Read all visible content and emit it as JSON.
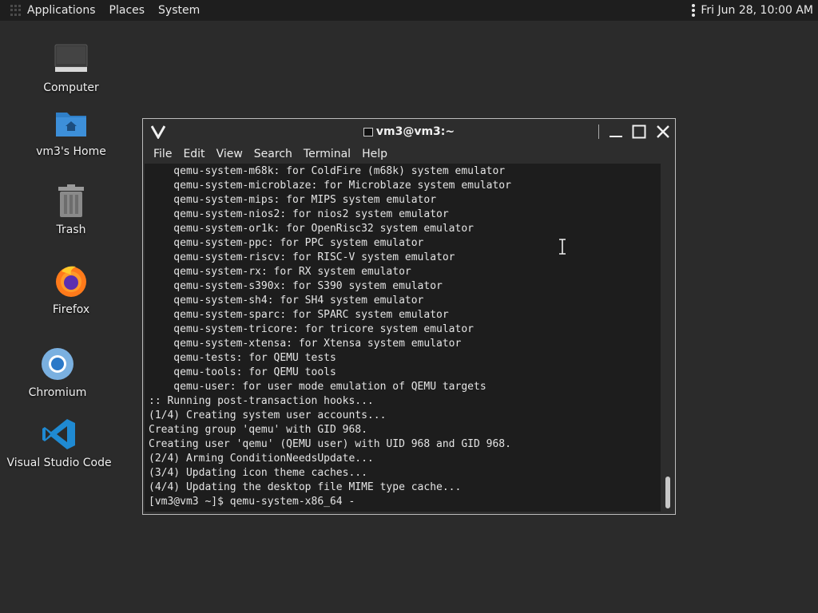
{
  "top_panel": {
    "menus": [
      "Applications",
      "Places",
      "System"
    ],
    "clock": "Fri Jun 28, 10:00 AM"
  },
  "desktop": {
    "icons": [
      {
        "label": "Computer",
        "icon": "computer-icon"
      },
      {
        "label": "vm3's Home",
        "icon": "home-folder-icon"
      },
      {
        "label": "Trash",
        "icon": "trash-icon"
      },
      {
        "label": "Firefox",
        "icon": "firefox-icon"
      },
      {
        "label": "Chromium",
        "icon": "chromium-icon"
      },
      {
        "label": "Visual Studio Code",
        "icon": "vscode-icon"
      }
    ]
  },
  "terminal": {
    "title": "vm3@vm3:~",
    "menu": [
      "File",
      "Edit",
      "View",
      "Search",
      "Terminal",
      "Help"
    ],
    "lines": [
      "    qemu-system-m68k: for ColdFire (m68k) system emulator",
      "    qemu-system-microblaze: for Microblaze system emulator",
      "    qemu-system-mips: for MIPS system emulator",
      "    qemu-system-nios2: for nios2 system emulator",
      "    qemu-system-or1k: for OpenRisc32 system emulator",
      "    qemu-system-ppc: for PPC system emulator",
      "    qemu-system-riscv: for RISC-V system emulator",
      "    qemu-system-rx: for RX system emulator",
      "    qemu-system-s390x: for S390 system emulator",
      "    qemu-system-sh4: for SH4 system emulator",
      "    qemu-system-sparc: for SPARC system emulator",
      "    qemu-system-tricore: for tricore system emulator",
      "    qemu-system-xtensa: for Xtensa system emulator",
      "    qemu-tests: for QEMU tests",
      "    qemu-tools: for QEMU tools",
      "    qemu-user: for user mode emulation of QEMU targets",
      ":: Running post-transaction hooks...",
      "(1/4) Creating system user accounts...",
      "Creating group 'qemu' with GID 968.",
      "Creating user 'qemu' (QEMU user) with UID 968 and GID 968.",
      "(2/4) Arming ConditionNeedsUpdate...",
      "(3/4) Updating icon theme caches...",
      "(4/4) Updating the desktop file MIME type cache...",
      "[vm3@vm3 ~]$ qemu-system-x86_64 -"
    ]
  },
  "colors": {
    "desktop_bg": "#2b2b2b",
    "panel_bg": "#1e1e1e",
    "terminal_bg": "#1d1d1d",
    "folder_blue": "#3d8fd9",
    "vscode_blue": "#1f8ad2"
  }
}
